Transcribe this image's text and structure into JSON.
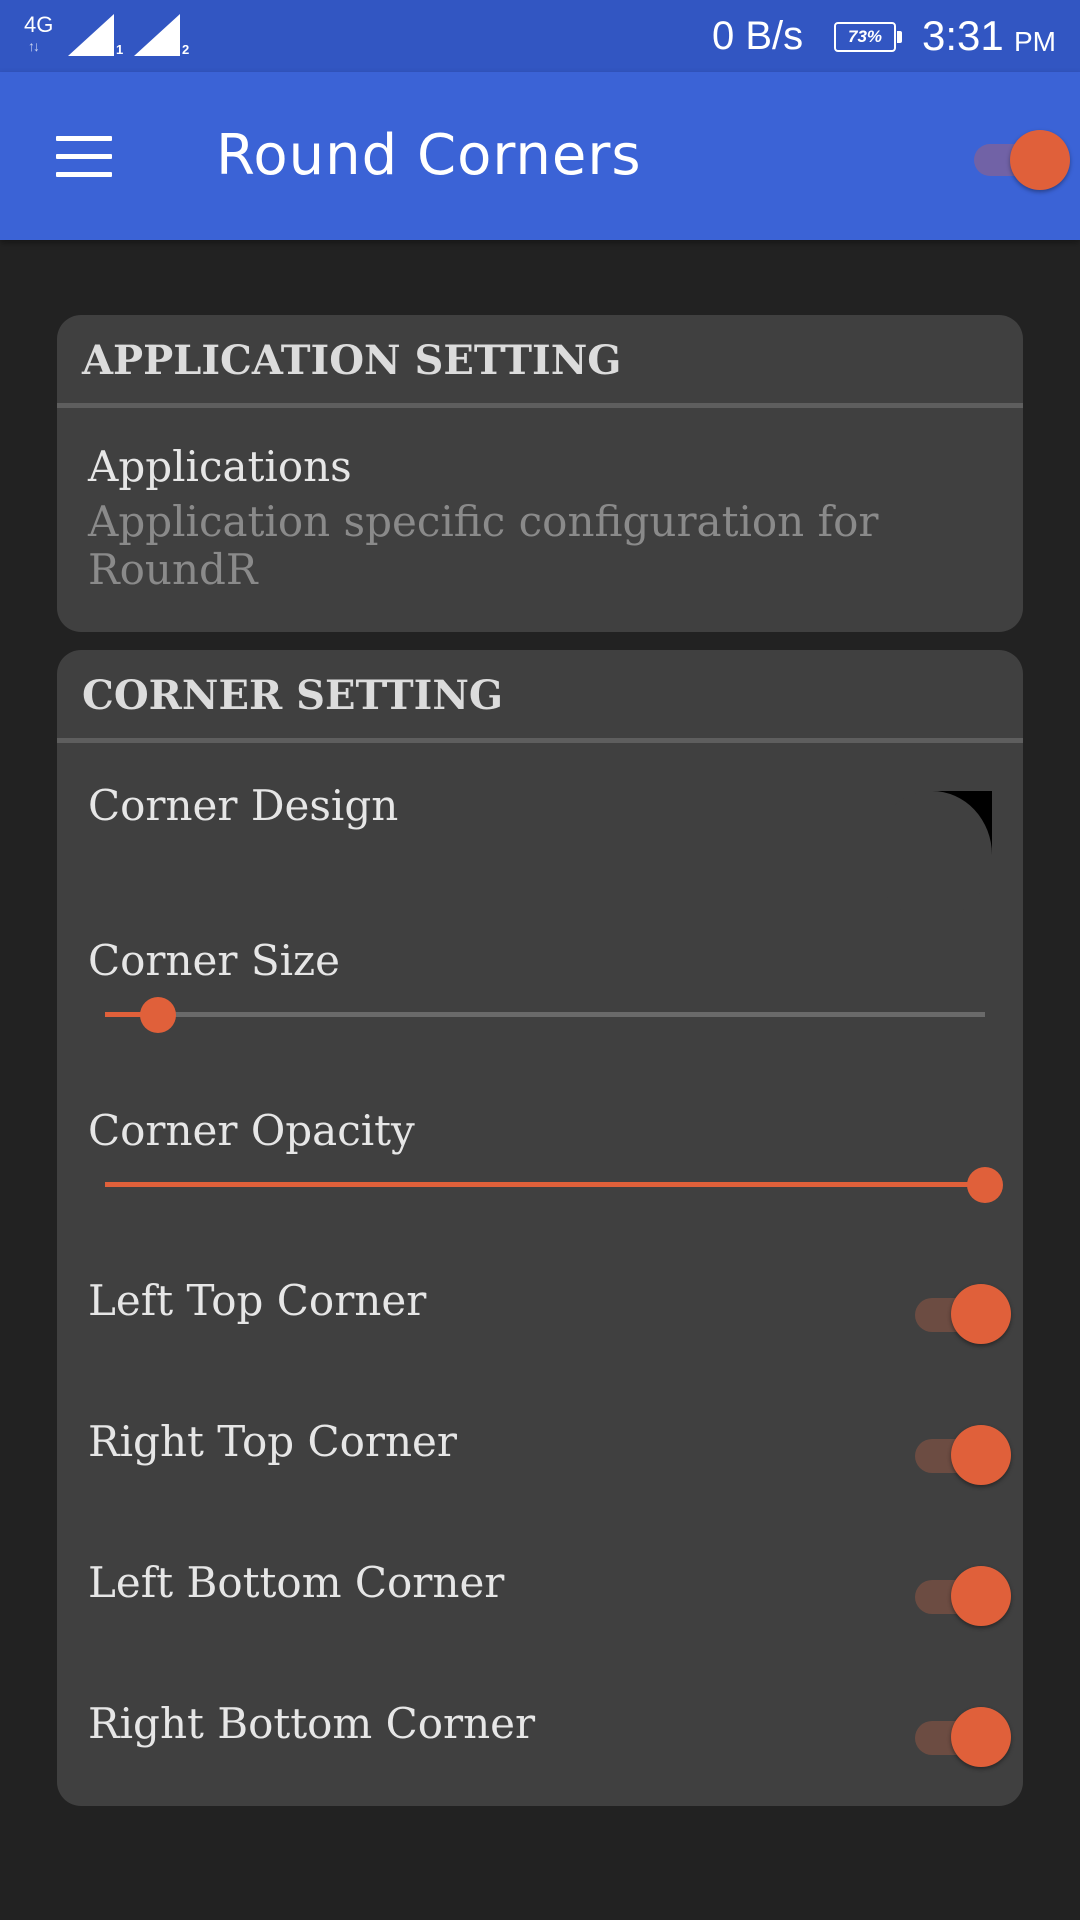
{
  "status_bar": {
    "network": "4G",
    "sim1": "1",
    "sim2": "2",
    "speed": "0 B/s",
    "battery": "73%",
    "time": "3:31",
    "ampm": "PM"
  },
  "app_bar": {
    "title": "Round Corners",
    "service_enabled": true,
    "menu_icon": "menu-icon"
  },
  "application_setting": {
    "header": "APPLICATION SETTING",
    "applications": {
      "title": "Applications",
      "summary": "Application specific configuration for RoundR"
    }
  },
  "corner_setting": {
    "header": "CORNER SETTING",
    "corner_design": {
      "title": "Corner Design"
    },
    "corner_size": {
      "title": "Corner Size",
      "value_fraction": 0.06
    },
    "corner_opacity": {
      "title": "Corner Opacity",
      "value_fraction": 1.0
    },
    "toggles": [
      {
        "label": "Left Top Corner",
        "on": true
      },
      {
        "label": "Right Top Corner",
        "on": true
      },
      {
        "label": "Left Bottom Corner",
        "on": true
      },
      {
        "label": "Right Bottom Corner",
        "on": true
      }
    ]
  },
  "colors": {
    "status_bar": "#3256c2",
    "app_bar": "#3b63d6",
    "accent": "#e0603a",
    "card": "#404040",
    "background": "#222222"
  }
}
